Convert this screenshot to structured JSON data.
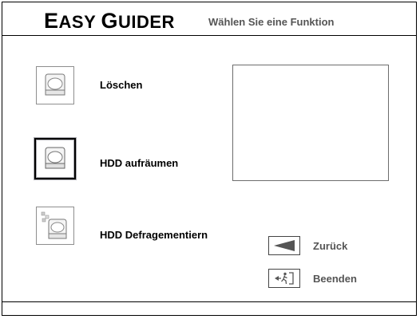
{
  "header": {
    "logo_first": "Easy",
    "logo_second": "Guider",
    "subtitle": "Wählen Sie eine Funktion"
  },
  "menu": {
    "items": [
      {
        "label": "Löschen",
        "icon": "hdd-erase-icon",
        "selected": false
      },
      {
        "label": "HDD aufräumen",
        "icon": "hdd-cleanup-icon",
        "selected": true
      },
      {
        "label": "HDD Defragementiern",
        "icon": "hdd-defrag-icon",
        "selected": false
      }
    ]
  },
  "nav": {
    "back_label": "Zurück",
    "exit_label": "Beenden",
    "back_icon": "back-arrow-icon",
    "exit_icon": "exit-icon"
  }
}
